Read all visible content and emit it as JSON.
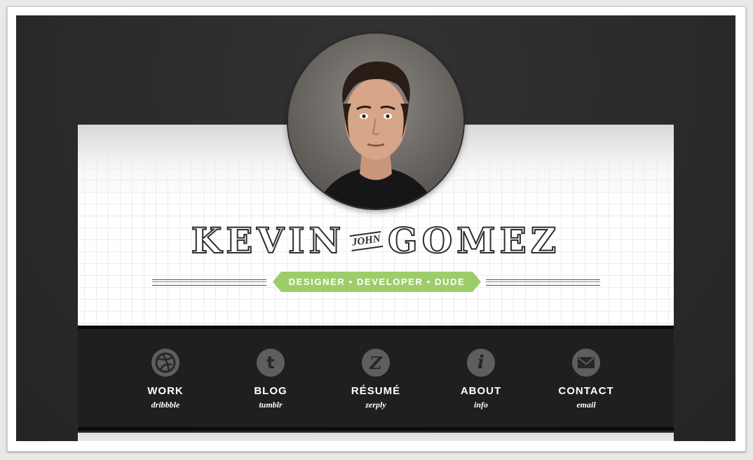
{
  "site": {
    "name_first": "KEVIN",
    "name_middle": "JOHN",
    "name_last": "GOMEZ",
    "tagline": "DESIGNER • DEVELOPER • DUDE",
    "accent_color": "#9ccd6a"
  },
  "nav": {
    "items": [
      {
        "label": "WORK",
        "sub": "dribbble",
        "icon": "dribbble-icon",
        "glyph": ""
      },
      {
        "label": "BLOG",
        "sub": "tumblr",
        "icon": "tumblr-icon",
        "glyph": "t"
      },
      {
        "label": "RÉSUMÉ",
        "sub": "zerply",
        "icon": "zerply-icon",
        "glyph": "Z"
      },
      {
        "label": "ABOUT",
        "sub": "info",
        "icon": "info-icon",
        "glyph": "i"
      },
      {
        "label": "CONTACT",
        "sub": "email",
        "icon": "mail-icon",
        "glyph": ""
      }
    ]
  }
}
